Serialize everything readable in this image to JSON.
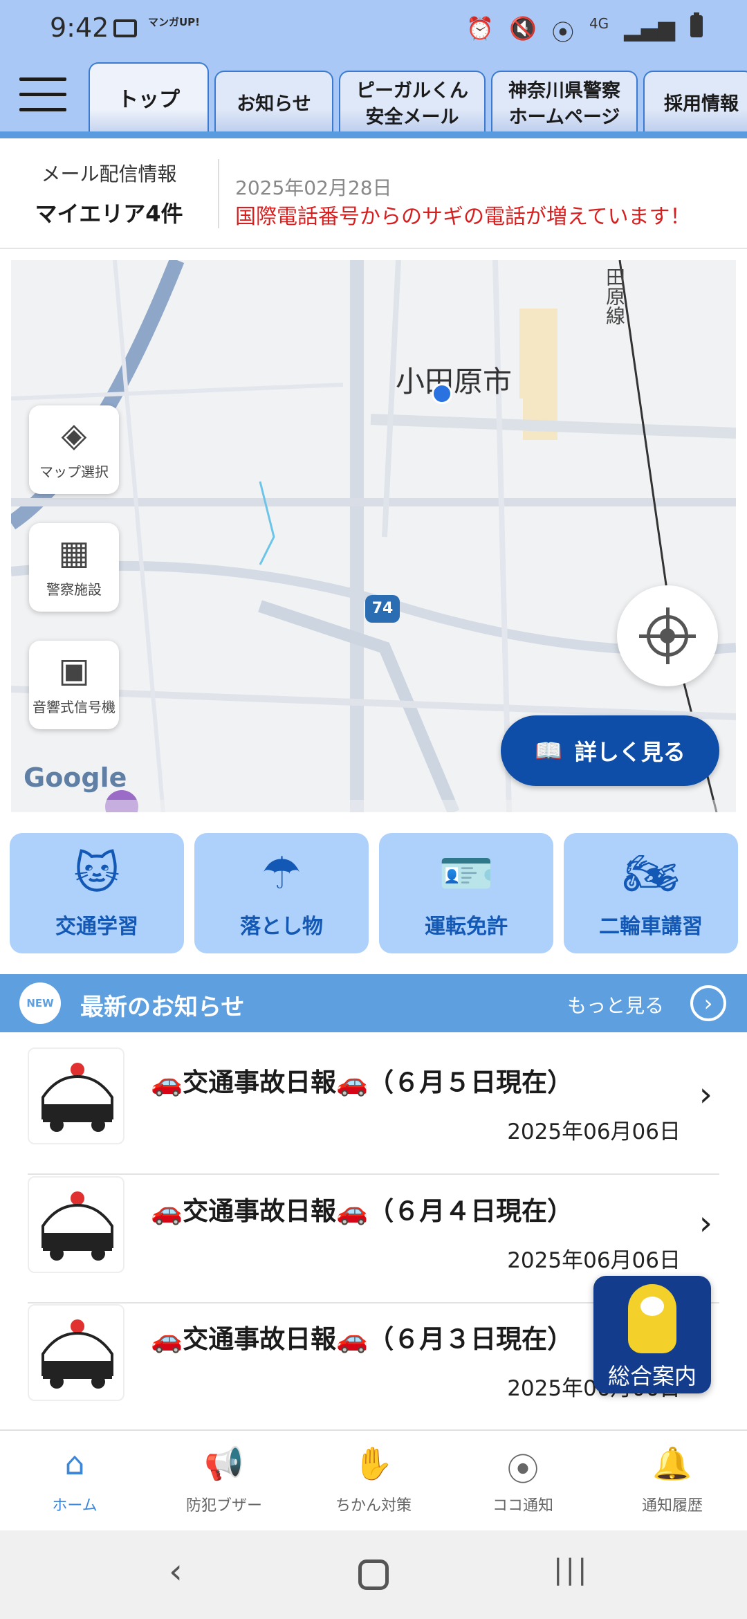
{
  "status_bar": {
    "time": "9:42",
    "app_badge": "マンガUP!",
    "network": "4G"
  },
  "header": {
    "tabs": [
      {
        "label": "トップ"
      },
      {
        "label": "お知らせ"
      },
      {
        "label": "ピーガルくん\n安全メール"
      },
      {
        "label": "神奈川県警察\nホームページ"
      },
      {
        "label": "採用情報"
      }
    ]
  },
  "mail_info": {
    "heading": "メール配信情報",
    "area_count": "マイエリア4件",
    "date": "2025年02月28日",
    "alert": "国際電話番号からのサギの電話が増えています！"
  },
  "map": {
    "city_label": "小田原市",
    "rail_label": "田原線",
    "route_number": "74",
    "google_logo": "Google",
    "side_buttons": [
      {
        "label": "マップ選択",
        "icon": "layers-icon"
      },
      {
        "label": "警察施設",
        "icon": "police-station-icon"
      },
      {
        "label": "音響式信号機",
        "icon": "signal-icon"
      }
    ],
    "detail_button": "詳しく見る"
  },
  "quick_links": [
    {
      "label": "交通学習",
      "icon": "cat-mascot-icon"
    },
    {
      "label": "落とし物",
      "icon": "lost-item-icon"
    },
    {
      "label": "運転免許",
      "icon": "license-card-icon"
    },
    {
      "label": "二輪車講習",
      "icon": "motorcycle-icon"
    }
  ],
  "news": {
    "badge": "NEW",
    "title": "最新のお知らせ",
    "more": "もっと見る",
    "items": [
      {
        "title": "🚗交通事故日報🚗（６月５日現在）",
        "date": "2025年06月06日"
      },
      {
        "title": "🚗交通事故日報🚗（６月４日現在）",
        "date": "2025年06月06日"
      },
      {
        "title": "🚗交通事故日報🚗（６月３日現在）",
        "date": "2025年06月06日"
      }
    ]
  },
  "floating_guide": {
    "label": "総合案内"
  },
  "bottom_nav": [
    {
      "label": "ホーム",
      "icon": "home-icon"
    },
    {
      "label": "防犯ブザー",
      "icon": "megaphone-icon"
    },
    {
      "label": "ちかん対策",
      "icon": "hand-stop-icon"
    },
    {
      "label": "ココ通知",
      "icon": "location-pin-icon"
    },
    {
      "label": "通知履歴",
      "icon": "bell-icon"
    }
  ],
  "colors": {
    "header_bg": "#a9c8f5",
    "accent": "#0f4ea8",
    "quick_bg": "#aed1fb",
    "news_bar": "#5e9fe0",
    "alert_red": "#d62020",
    "nav_active": "#3d86d8"
  }
}
